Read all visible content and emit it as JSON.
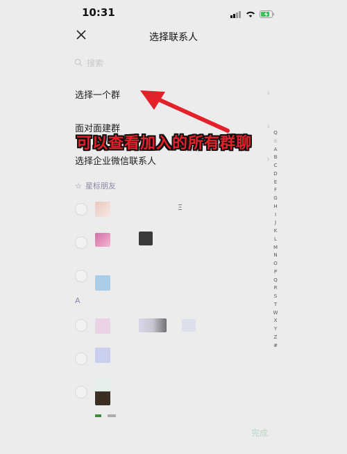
{
  "status_bar": {
    "time": "10:31"
  },
  "header": {
    "title": "选择联系人"
  },
  "search": {
    "placeholder": "搜索"
  },
  "menu": [
    {
      "label": "选择一个群"
    },
    {
      "label": "面对面建群"
    },
    {
      "label": "选择企业微信联系人"
    }
  ],
  "annotation": {
    "text": "可以查看加入的所有群聊",
    "color": "#e3212a"
  },
  "sections": {
    "starred_label": "星标朋友",
    "letter_a": "A"
  },
  "contacts_partial_text": "Ξ",
  "index_letters": [
    "Q",
    "☆",
    "A",
    "B",
    "C",
    "D",
    "E",
    "F",
    "G",
    "H",
    "I",
    "J",
    "K",
    "L",
    "M",
    "N",
    "O",
    "P",
    "Q",
    "R",
    "S",
    "T",
    "W",
    "X",
    "Y",
    "Z",
    "#"
  ],
  "footer": {
    "done_label": "完成"
  },
  "colors": {
    "accent_disabled": "#b8d8c6",
    "background": "#ececed"
  }
}
